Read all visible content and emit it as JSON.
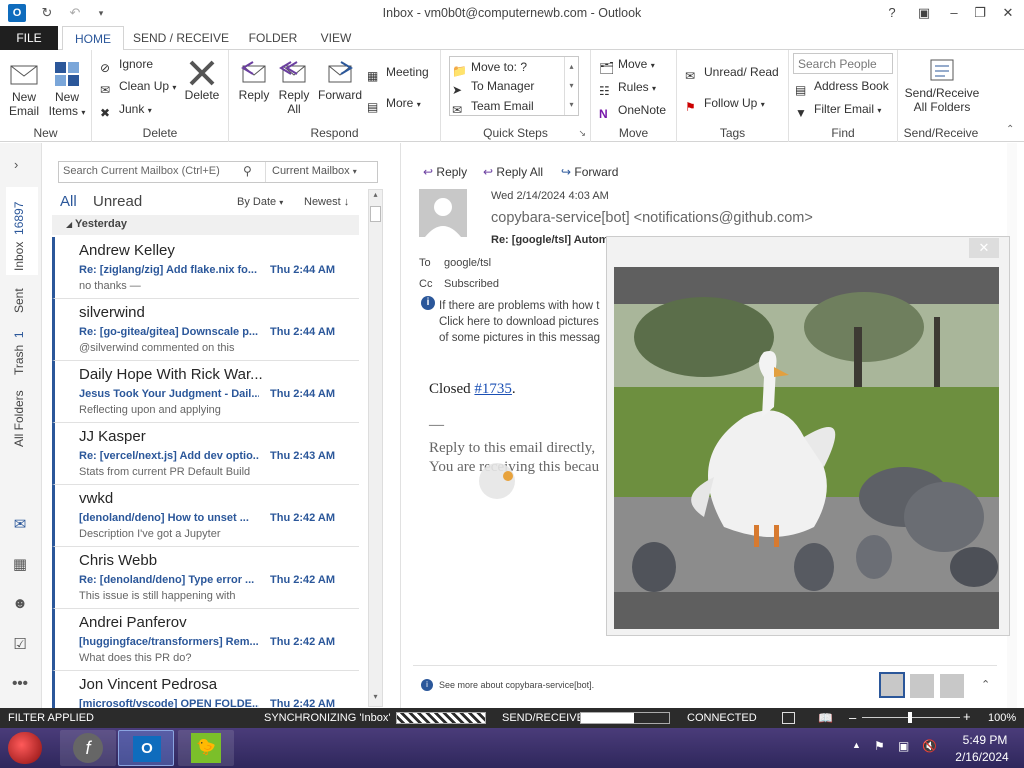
{
  "window": {
    "title": "Inbox - vm0b0t@computernewb.com - Outlook"
  },
  "tabs": [
    "FILE",
    "HOME",
    "SEND / RECEIVE",
    "FOLDER",
    "VIEW"
  ],
  "ribbon": {
    "new_email": "New Email",
    "new_email_l1": "New",
    "new_email_l2": "Email",
    "new_items_l1": "New",
    "new_items_l2": "Items",
    "group_new": "New",
    "ignore": "Ignore",
    "clean_up": "Clean Up",
    "junk": "Junk",
    "delete": "Delete",
    "group_delete": "Delete",
    "reply": "Reply",
    "reply_all_l1": "Reply",
    "reply_all_l2": "All",
    "forward": "Forward",
    "meeting": "Meeting",
    "more": "More",
    "group_respond": "Respond",
    "qs_move_to": "Move to: ?",
    "qs_to_manager": "To Manager",
    "qs_team_email": "Team Email",
    "group_quick_steps": "Quick Steps",
    "move": "Move",
    "rules": "Rules",
    "onenote": "OneNote",
    "group_move": "Move",
    "unread_read": "Unread/ Read",
    "follow_up": "Follow Up",
    "group_tags": "Tags",
    "search_people_placeholder": "Search People",
    "address_book": "Address Book",
    "filter_email": "Filter Email",
    "group_find": "Find",
    "send_receive_l1": "Send/Receive",
    "send_receive_l2": "All Folders",
    "group_send_receive": "Send/Receive"
  },
  "nav": {
    "inbox": "Inbox",
    "inbox_count": "16897",
    "sent": "Sent",
    "trash": "Trash",
    "trash_count": "1",
    "all_folders": "All Folders"
  },
  "list": {
    "search_placeholder": "Search Current Mailbox (Ctrl+E)",
    "scope": "Current Mailbox",
    "filter_all": "All",
    "filter_unread": "Unread",
    "sort_by": "By Date",
    "sort_order": "Newest",
    "group_header": "Yesterday",
    "items": [
      {
        "sender": "Andrew Kelley",
        "subject": "Re: [ziglang/zig] Add flake.nix fo...",
        "time": "Thu 2:44 AM",
        "preview": "no thanks  —"
      },
      {
        "sender": "silverwind",
        "subject": "Re: [go-gitea/gitea] Downscale p...",
        "time": "Thu 2:44 AM",
        "preview": "@silverwind commented on this"
      },
      {
        "sender": "Daily Hope With Rick War...",
        "subject": "Jesus Took Your Judgment - Dail...",
        "time": "Thu 2:44 AM",
        "preview": "Reflecting upon and applying"
      },
      {
        "sender": "JJ Kasper",
        "subject": "Re: [vercel/next.js] Add dev optio...",
        "time": "Thu 2:43 AM",
        "preview": "Stats from current PR  Default Build"
      },
      {
        "sender": "vwkd",
        "subject": "[denoland/deno] How to unset ...",
        "time": "Thu 2:42 AM",
        "preview": "Description  I've got a Jupyter"
      },
      {
        "sender": "Chris Webb",
        "subject": "Re: [denoland/deno] Type error ...",
        "time": "Thu 2:42 AM",
        "preview": "This issue is still happening with"
      },
      {
        "sender": "Andrei Panferov",
        "subject": "[huggingface/transformers] Rem...",
        "time": "Thu 2:42 AM",
        "preview": "What does this PR do?"
      },
      {
        "sender": "Jon Vincent Pedrosa",
        "subject": "[microsoft/vscode] OPEN FOLDE...",
        "time": "Thu 2:42 AM",
        "preview": ""
      }
    ]
  },
  "reading": {
    "reply": "Reply",
    "reply_all": "Reply All",
    "forward": "Forward",
    "date": "Wed 2/14/2024 4:03 AM",
    "from": "copybara-service[bot] <notifications@github.com>",
    "subject": "Re: [google/tsl] Autom",
    "to_label": "To",
    "to": "google/tsl",
    "cc_label": "Cc",
    "cc": "Subscribed",
    "info_l1": "If there are problems with how t",
    "info_l2": "Click here to download pictures",
    "info_l3": "of some pictures in this messag",
    "body_closed": "Closed ",
    "body_link": "#1735",
    "body_dot": ".",
    "body_dash": "—",
    "body_reply": "Reply to this email directly,",
    "body_receiving": "You are receiving this becau",
    "people_info": "See more about copybara-service[bot]."
  },
  "status": {
    "filter": "FILTER APPLIED",
    "sync": "SYNCHRONIZING  'Inbox'",
    "send_receive": "SEND/RECEIVE",
    "connected": "CONNECTED",
    "zoom": "100%",
    "sync_progress": 0.3,
    "send_progress": 0.6
  },
  "taskbar": {
    "time": "5:49 PM",
    "date": "2/16/2024"
  },
  "colors": {
    "accent": "#2b579a",
    "file_tab": "#1f1f1f",
    "statusbar": "#2b2b2b"
  }
}
